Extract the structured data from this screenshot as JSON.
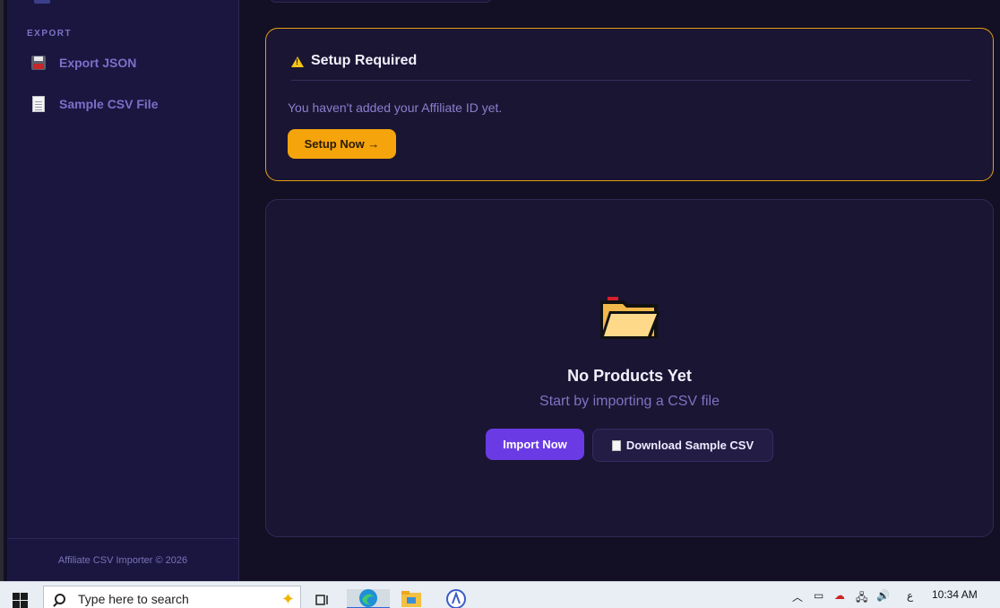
{
  "sidebar": {
    "section_export": "EXPORT",
    "items": [
      {
        "label": "Export JSON",
        "icon": "floppy-disk-icon"
      },
      {
        "label": "Sample CSV File",
        "icon": "document-icon"
      }
    ],
    "footer": "Affiliate CSV Importer © 2026"
  },
  "setup": {
    "title": "Setup Required",
    "message": "You haven't added your Affiliate ID yet.",
    "button": "Setup Now →"
  },
  "empty_state": {
    "icon": "open-folder-icon",
    "title": "No Products Yet",
    "subtitle": "Start by importing a CSV file",
    "primary_button": "Import Now",
    "secondary_button": "Download Sample CSV"
  },
  "taskbar": {
    "search_placeholder": "Type here to search",
    "time": "10:34 AM",
    "tray_lang": "ع"
  },
  "colors": {
    "background": "#130f24",
    "sidebar": "#1a1640",
    "accent_orange": "#f5a40c",
    "accent_purple": "#6a3be4",
    "warning_border": "#e59f14"
  }
}
